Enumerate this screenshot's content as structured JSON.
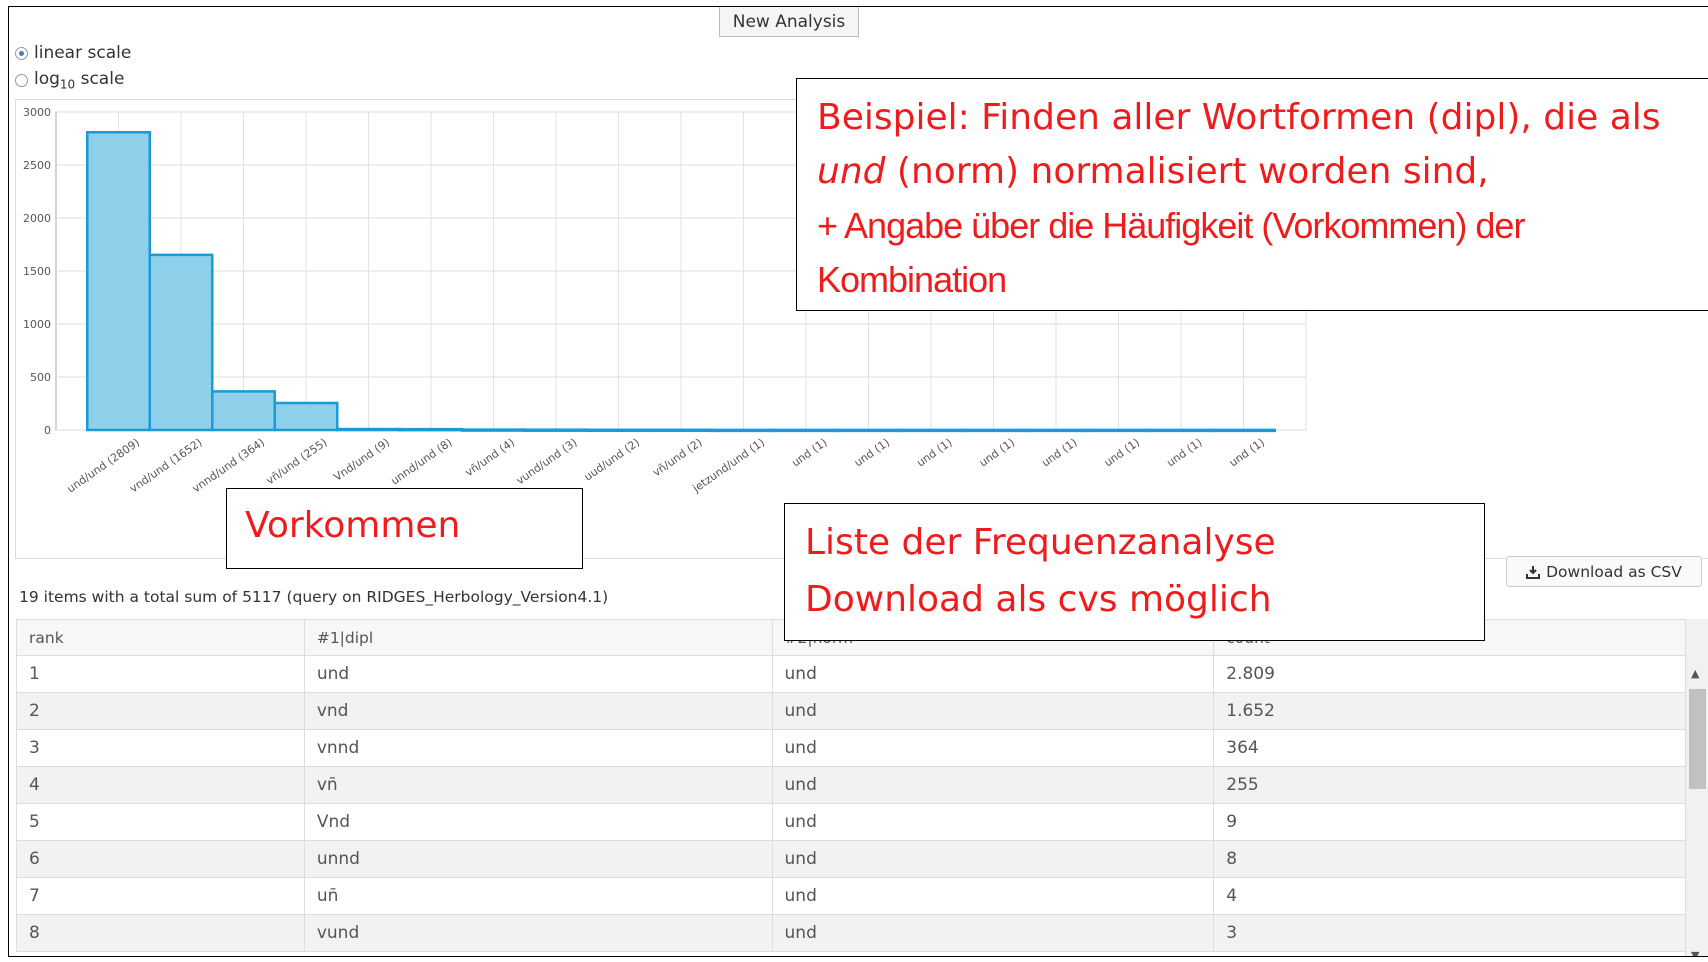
{
  "toolbar": {
    "new_analysis": "New Analysis"
  },
  "scale": {
    "linear": "linear scale",
    "log_prefix": "log",
    "log_sub": "10",
    "log_suffix": " scale",
    "selected": "linear"
  },
  "chart_data": {
    "type": "bar",
    "categories": [
      "und/und (2809)",
      "vnd/und (1652)",
      "vnnd/und (364)",
      "vn̄/und (255)",
      "Vnd/und (9)",
      "unnd/und (8)",
      "vn̄/und (4)",
      "vund/und (3)",
      "uud/und (2)",
      "vñ/und (2)",
      "jetzund/und (1)",
      "und (1)",
      "und (1)",
      "und (1)",
      "und (1)",
      "und (1)",
      "und (1)",
      "und (1)",
      "und (1)"
    ],
    "values": [
      2809,
      1652,
      364,
      255,
      9,
      8,
      4,
      3,
      2,
      2,
      1,
      1,
      1,
      1,
      1,
      1,
      1,
      1,
      1
    ],
    "yticks": [
      "0",
      "500",
      "1000",
      "1500",
      "2000",
      "2500",
      "3000"
    ],
    "ylim": [
      0,
      3000
    ],
    "bar_fill": "#8ecfea",
    "bar_stroke": "#1a9ad6"
  },
  "callouts": {
    "example_line1": "Beispiel: Finden aller Wortformen (dipl), die als",
    "example_line2_italic": "und",
    "example_line2_rest": " (norm) normalisiert worden sind,",
    "example_line3": "+ Angabe über die Häufigkeit (Vorkommen) der",
    "example_line4": "Kombination",
    "vorkommen": "Vorkommen",
    "liste_line1": "Liste der Frequenzanalyse",
    "liste_line2": "Download als cvs möglich",
    "color": "#ee1c1c"
  },
  "summary": "19 items with a total sum of 5117 (query on RIDGES_Herbology_Version4.1)",
  "download_csv": "Download as CSV",
  "table": {
    "headers": [
      "rank",
      "#1|dipl",
      "#2|norm",
      "count"
    ],
    "rows": [
      [
        "1",
        "und",
        "und",
        "2.809"
      ],
      [
        "2",
        "vnd",
        "und",
        "1.652"
      ],
      [
        "3",
        "vnnd",
        "und",
        "364"
      ],
      [
        "4",
        "vn̄",
        "und",
        "255"
      ],
      [
        "5",
        "Vnd",
        "und",
        "9"
      ],
      [
        "6",
        "unnd",
        "und",
        "8"
      ],
      [
        "7",
        "un̄",
        "und",
        "4"
      ],
      [
        "8",
        "vund",
        "und",
        "3"
      ]
    ]
  },
  "icons": {
    "radio": "radio-icon",
    "download": "download-icon",
    "scroll_up": "chevron-up-icon",
    "scroll_down": "chevron-down-icon"
  }
}
